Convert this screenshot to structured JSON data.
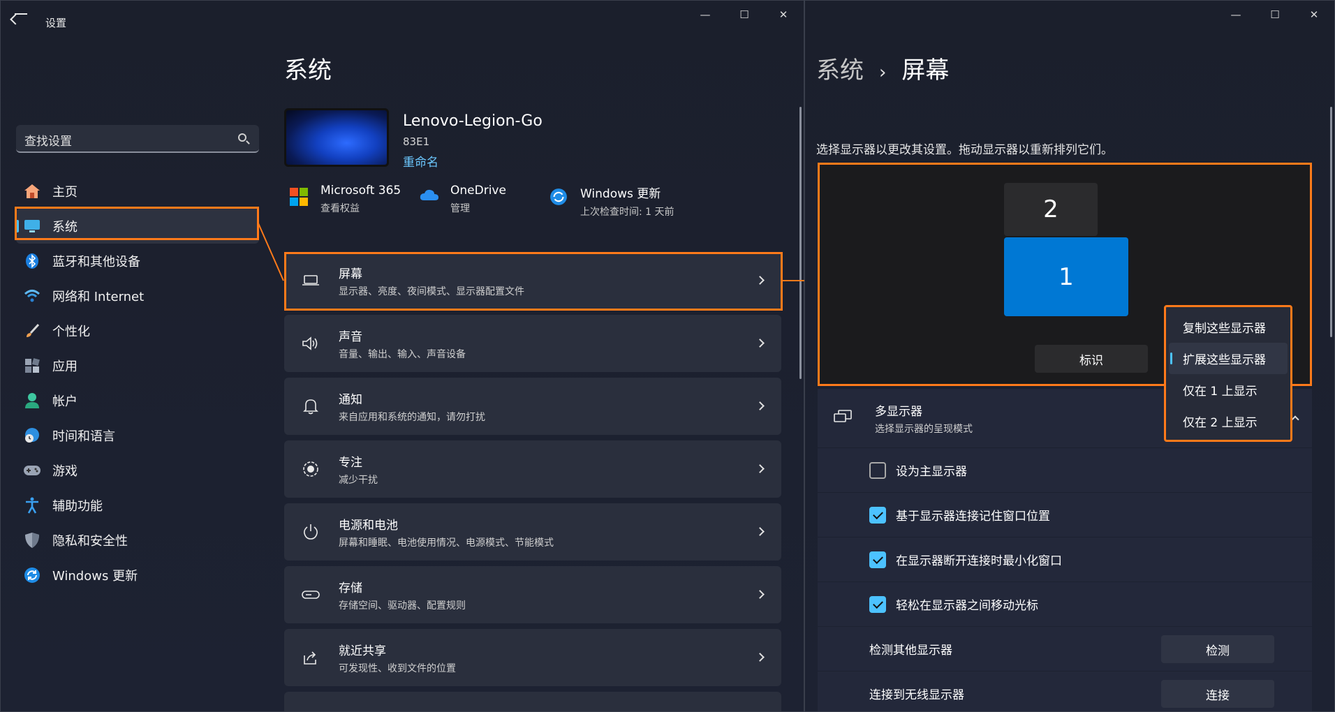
{
  "left_window": {
    "title": "设置",
    "controls": [
      "—",
      "☐",
      "✕"
    ],
    "search_placeholder": "查找设置",
    "nav": [
      {
        "label": "主页",
        "icon": "home-icon"
      },
      {
        "label": "系统",
        "icon": "monitor-icon",
        "selected": true
      },
      {
        "label": "蓝牙和其他设备",
        "icon": "bluetooth-icon"
      },
      {
        "label": "网络和 Internet",
        "icon": "wifi-icon"
      },
      {
        "label": "个性化",
        "icon": "brush-icon"
      },
      {
        "label": "应用",
        "icon": "apps-icon"
      },
      {
        "label": "帐户",
        "icon": "account-icon"
      },
      {
        "label": "时间和语言",
        "icon": "globe-clock-icon"
      },
      {
        "label": "游戏",
        "icon": "gamepad-icon"
      },
      {
        "label": "辅助功能",
        "icon": "accessibility-icon"
      },
      {
        "label": "隐私和安全性",
        "icon": "shield-icon"
      },
      {
        "label": "Windows 更新",
        "icon": "update-icon"
      }
    ],
    "heading": "系统",
    "device": {
      "name": "Lenovo-Legion-Go",
      "model": "83E1",
      "rename": "重命名"
    },
    "quick": [
      {
        "title": "Microsoft 365",
        "sub": "查看权益",
        "icon": "microsoft-logo-icon"
      },
      {
        "title": "OneDrive",
        "sub": "管理",
        "icon": "cloud-icon"
      },
      {
        "title": "Windows 更新",
        "sub": "上次检查时间: 1 天前",
        "icon": "update-icon"
      }
    ],
    "cards": [
      {
        "title": "屏幕",
        "sub": "显示器、亮度、夜间模式、显示器配置文件",
        "icon": "laptop-icon"
      },
      {
        "title": "声音",
        "sub": "音量、输出、输入、声音设备",
        "icon": "speaker-icon"
      },
      {
        "title": "通知",
        "sub": "来自应用和系统的通知，请勿打扰",
        "icon": "bell-icon"
      },
      {
        "title": "专注",
        "sub": "减少干扰",
        "icon": "focus-icon"
      },
      {
        "title": "电源和电池",
        "sub": "屏幕和睡眠、电池使用情况、电源模式、节能模式",
        "icon": "power-icon"
      },
      {
        "title": "存储",
        "sub": "存储空间、驱动器、配置规则",
        "icon": "storage-icon"
      },
      {
        "title": "就近共享",
        "sub": "可发现性、收到文件的位置",
        "icon": "share-icon"
      }
    ]
  },
  "right_window": {
    "breadcrumb": {
      "parent": "系统",
      "sep": "›",
      "current": "屏幕"
    },
    "description": "选择显示器以更改其设置。拖动显示器以重新排列它们。",
    "monitors": {
      "m2": "2",
      "m1": "1",
      "identify": "标识"
    },
    "multi": {
      "title": "多显示器",
      "sub": "选择显示器的呈现模式"
    },
    "checks": [
      {
        "label": "设为主显示器",
        "checked": false
      },
      {
        "label": "基于显示器连接记住窗口位置",
        "checked": true
      },
      {
        "label": "在显示器断开连接时最小化窗口",
        "checked": true
      },
      {
        "label": "轻松在显示器之间移动光标",
        "checked": true
      }
    ],
    "detect": {
      "label": "检测其他显示器",
      "button": "检测"
    },
    "wireless": {
      "label": "连接到无线显示器",
      "button": "连接"
    },
    "dropdown": [
      "复制这些显示器",
      "扩展这些显示器",
      "仅在 1 上显示",
      "仅在 2 上显示"
    ],
    "dropdown_selected": "扩展这些显示器"
  },
  "colors": {
    "accent": "#4cc2ff",
    "highlight": "#ff7a1a",
    "monitor_active": "#0078d4"
  }
}
